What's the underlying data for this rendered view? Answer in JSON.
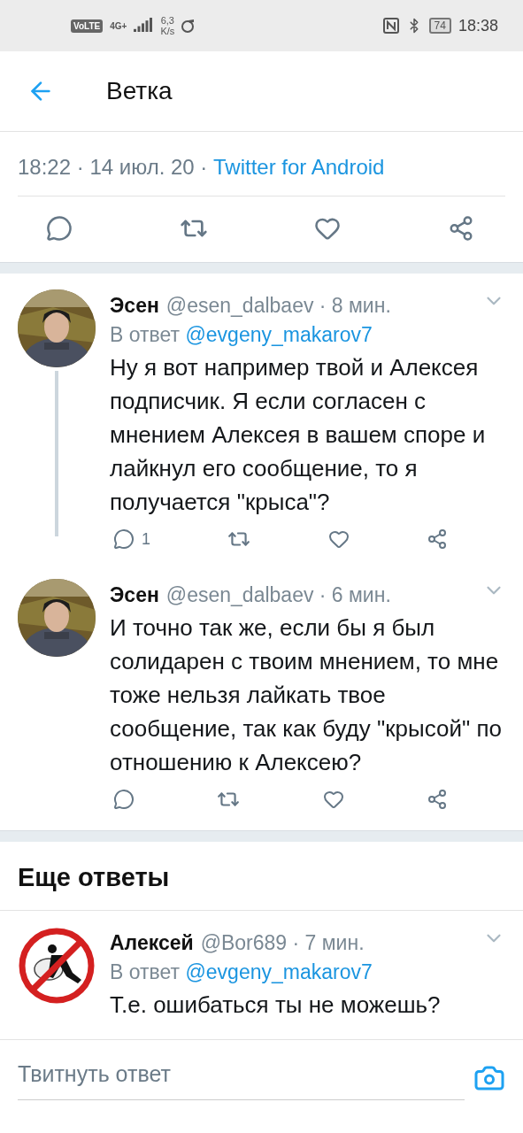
{
  "status_bar": {
    "network_badge": "VoLTE",
    "network_type": "4G+",
    "speed": "6,3",
    "speed_unit": "K/s",
    "battery": "74",
    "time": "18:38"
  },
  "header": {
    "title": "Ветка"
  },
  "main_tweet": {
    "timestamp": "18:22 · 14 июл. 20 ·",
    "source": "Twitter for Android"
  },
  "thread": [
    {
      "kind": "photo_avatar",
      "thread_line": true,
      "name": "Эсен",
      "meta": "@esen_dalbaev · 8 мин.",
      "reply_label": "В ответ",
      "reply_to": "@evgeny_makarov7",
      "text": "Ну я вот например твой и Алексея подписчик. Я если согласен с мнением Алексея в вашем споре и лайкнул его сообщение, то я получается \"крыса\"?",
      "reply_count": "1"
    },
    {
      "kind": "photo_avatar",
      "thread_line": false,
      "name": "Эсен",
      "meta": "@esen_dalbaev · 6 мин.",
      "text": "И точно так же, если бы я был солидарен с твоим мнением, то мне тоже нельзя лайкать твое сообщение, так как буду \"крысой\" по отношению к Алексею?"
    }
  ],
  "more_replies": {
    "title": "Еще ответы",
    "tweets": [
      {
        "kind": "sign_avatar",
        "thread_line": false,
        "name": "Алексей",
        "meta": "@Bor689 · 7 мин.",
        "reply_label": "В ответ",
        "reply_to": "@evgeny_makarov7",
        "text": "Т.е. ошибаться ты не можешь?"
      }
    ]
  },
  "compose": {
    "placeholder": "Твитнуть ответ"
  }
}
